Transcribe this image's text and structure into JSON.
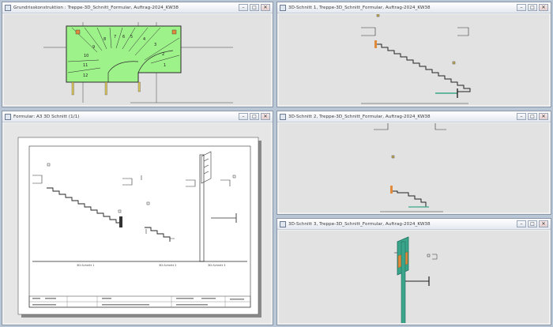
{
  "windows": {
    "grundriss": {
      "title": "Grundrisskonstruktion : Treppe-3D_Schnitt_Formular, Auftrag-2024_KW38"
    },
    "formular": {
      "title": "Formular: A3 3D Schnitt (1/1)"
    },
    "schnitt1": {
      "title": "3D-Schnitt 1, Treppe-3D_Schnitt_Formular, Auftrag-2024_KW38"
    },
    "schnitt2": {
      "title": "3D-Schnitt 2, Treppe-3D_Schnitt_Formular, Auftrag-2024_KW38"
    },
    "schnitt3": {
      "title": "3D-Schnitt 3, Treppe-3D_Schnitt_Formular, Auftrag-2024_KW38"
    }
  },
  "controls": {
    "minimize": "–",
    "maximize": "□",
    "close": "✕"
  },
  "plan": {
    "step_numbers": [
      "1",
      "2",
      "3",
      "4",
      "5",
      "6",
      "7",
      "8",
      "9",
      "10",
      "11",
      "12"
    ]
  },
  "sheet": {
    "labels": {
      "cut1": "3D-Schnitt 1",
      "cut2": "3D-Schnitt 2",
      "cut3": "3D-Schnitt 3"
    }
  },
  "colors": {
    "plan_fill": "#9ef28a",
    "section_fill": "#3aa58a",
    "accent_orange": "#e08a3c"
  }
}
